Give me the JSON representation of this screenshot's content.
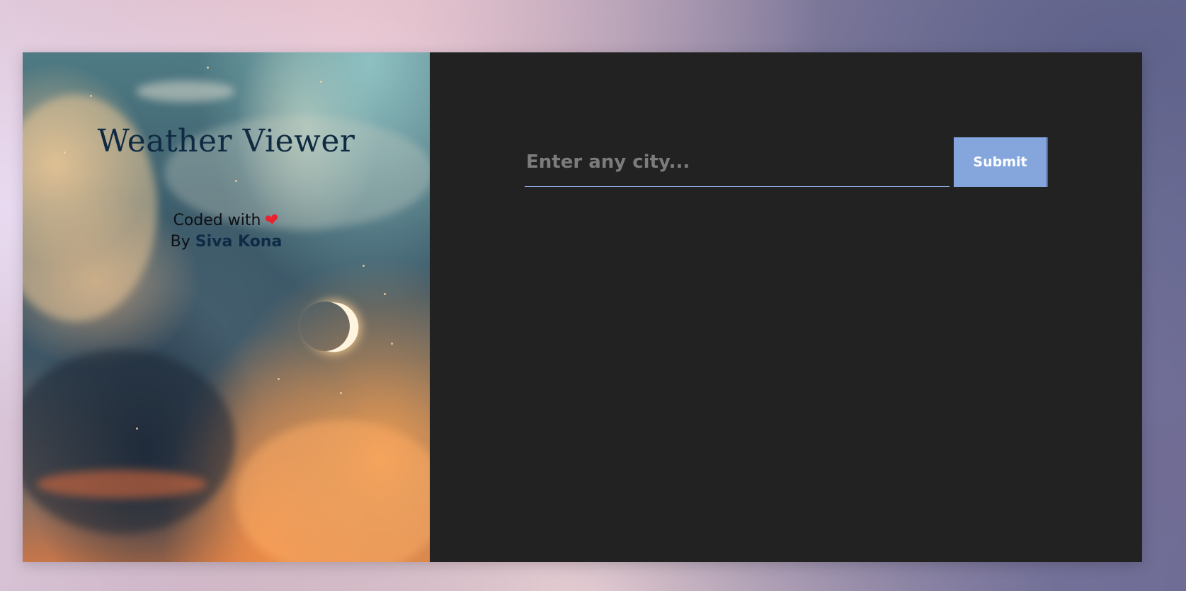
{
  "hero": {
    "title": "Weather Viewer",
    "credit_line": "Coded with",
    "heart_icon": "heart-icon",
    "by_label": "By",
    "author_name": "Siva Kona"
  },
  "search": {
    "placeholder": "Enter any city...",
    "value": "",
    "submit_label": "Submit"
  },
  "colors": {
    "panel_background": "#222222",
    "accent": "#85a6dd",
    "title_color": "#0f2a42",
    "heart_color": "#e8232f"
  }
}
